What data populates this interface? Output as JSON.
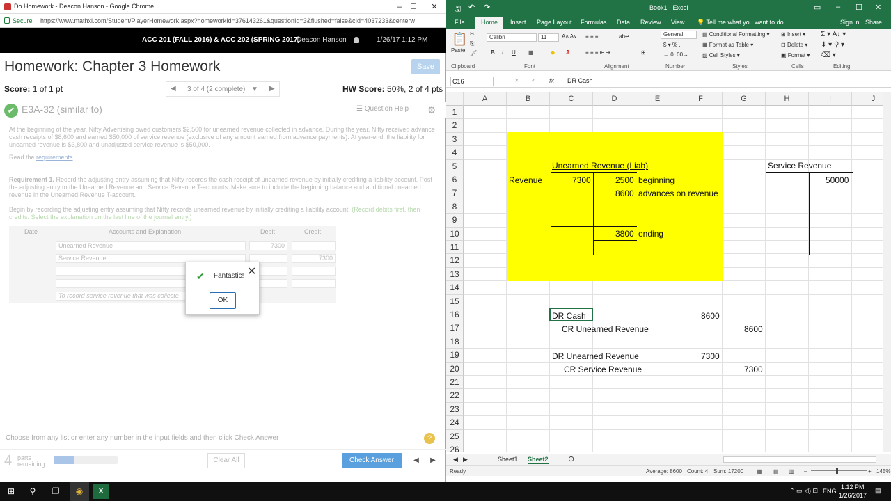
{
  "browser": {
    "window_title": "Do Homework - Deacon Hanson - Google Chrome",
    "secure_label": "Secure",
    "url": "https://www.mathxl.com/Student/PlayerHomework.aspx?homeworkId=376143261&questionId=3&flushed=false&cId=4037233&centerw",
    "minimize": "–",
    "maximize": "☐",
    "close": "✕"
  },
  "header": {
    "course": "ACC 201 (FALL 2016) & ACC 202 (SPRING 2017)",
    "user": "Deacon Hanson",
    "datetime": "1/26/17 1:12 PM"
  },
  "homework": {
    "title": "Homework: Chapter 3 Homework",
    "save_label": "Save",
    "score_label": "Score:",
    "score_value": "1 of 1 pt",
    "pager_text": "3 of 4 (2 complete)",
    "pager_prev": "◀",
    "pager_next": "▶",
    "pager_dropdown": "▼",
    "hw_score_label": "HW Score:",
    "hw_score_value": "50%, 2 of 4 pts",
    "question_id": "E3A-32 (similar to)",
    "check_icon": "✔",
    "help_label": "Question Help",
    "gear_glyph": "⚙",
    "problem_text": "At the beginning of the year, Nifty Advertising owed customers $2,500 for unearned revenue collected in advance. During the year, Nifty received advance cash receipts of $8,600 and earned $50,000 of service revenue (exclusive of any amount earned from advance payments). At year-end, the liability for unearned revenue is $3,800 and unadjusted service revenue is $50,000.",
    "read_prefix": "Read the ",
    "requirements_link": "requirements",
    "read_suffix": ".",
    "req1_bold": "Requirement 1.",
    "req1_text": " Record the adjusting entry assuming that Nifty records the cash receipt of unearned revenue by initially crediting a liability account. Post the adjusting entry to the Unearned Revenue and Service Revenue T-accounts. Make sure to include the beginning balance and additional unearned revenue in the Unearned Revenue T-account.",
    "begin_text": "Begin by recording the adjusting entry assuming that Nifty records unearned revenue by initially crediting a liability account. ",
    "begin_green": "(Record debits first, then credits. Select the explanation on the last line of the journal entry.)",
    "journal": {
      "headers": {
        "date": "Date",
        "accounts": "Accounts and Explanation",
        "debit": "Debit",
        "credit": "Credit"
      },
      "rows": [
        {
          "account": "Unearned Revenue",
          "debit": "7300",
          "credit": ""
        },
        {
          "account": "Service Revenue",
          "debit": "",
          "credit": "7300"
        },
        {
          "account": "",
          "debit": "",
          "credit": ""
        },
        {
          "account": "",
          "debit": "",
          "credit": ""
        }
      ],
      "explanation": "To record service revenue that was collecte"
    },
    "dialog": {
      "message": "Fantastic!",
      "ok": "OK",
      "close": "✕",
      "check": "✔"
    },
    "footer_msg": "Choose from any list or enter any number in the input fields and then click Check Answer",
    "help_q": "?",
    "parts_count": "4",
    "parts_label1": "parts",
    "parts_label2": "remaining",
    "progress": 0.33,
    "clear_all": "Clear All",
    "check_answer": "Check Answer",
    "nav_prev": "◀",
    "nav_next": "▶"
  },
  "excel": {
    "title": "Book1 - Excel",
    "tabs": [
      "File",
      "Home",
      "Insert",
      "Page Layout",
      "Formulas",
      "Data",
      "Review",
      "View"
    ],
    "tell_me": "Tell me what you want to do...",
    "sign_in": "Sign in",
    "share": "Share",
    "ribbon": {
      "paste": "Paste",
      "font_name": "Calibri",
      "font_size": "11",
      "number_format": "General",
      "conditional": "Conditional Formatting",
      "format_table": "Format as Table",
      "cell_styles": "Cell Styles",
      "insert": "Insert",
      "delete": "Delete",
      "format": "Format",
      "groups": [
        "Clipboard",
        "Font",
        "Alignment",
        "Number",
        "Styles",
        "Cells",
        "Editing"
      ]
    },
    "name_box": "C16",
    "formula": "DR Cash",
    "fx": "fx",
    "columns": [
      "A",
      "B",
      "C",
      "D",
      "E",
      "F",
      "G",
      "H",
      "I",
      "J"
    ],
    "rows": [
      "1",
      "2",
      "3",
      "4",
      "5",
      "6",
      "7",
      "8",
      "9",
      "10",
      "11",
      "12",
      "13",
      "14",
      "15",
      "16",
      "17",
      "18",
      "19",
      "20",
      "21",
      "22",
      "23",
      "24",
      "25",
      "26"
    ],
    "cells": {
      "unearned_title": "Unearned Revenue (Liab)",
      "service_title": "Service Revenue",
      "revenue_label": "Revenue",
      "d_7300": "7300",
      "e_2500": "2500",
      "beginning": "beginning",
      "e_8600": "8600",
      "advances": "advances on revenue",
      "e_3800": "3800",
      "ending": "ending",
      "sr_50000": "50000",
      "dr_cash": "DR Cash",
      "dr_cash_amt": "8600",
      "cr_unearned": "CR Unearned Revenue",
      "cr_unearned_amt": "8600",
      "dr_unearned": "DR Unearned Revenue",
      "dr_unearned_amt": "7300",
      "cr_service": "CR Service Revenue",
      "cr_service_amt": "7300"
    },
    "sheets": [
      "Sheet1",
      "Sheet2"
    ],
    "add_sheet": "⊕",
    "status": {
      "ready": "Ready",
      "average": "Average: 8600",
      "count": "Count: 4",
      "sum": "Sum: 17200",
      "zoom": "145%"
    }
  },
  "taskbar": {
    "time": "1:12 PM",
    "date": "1/26/2017",
    "lang": "ENG",
    "start_icon": "⊞",
    "search_icon": "⚲",
    "taskview_icon": "❐",
    "chrome_icon": "◉",
    "excel_icon": "X",
    "tray_icons": "⌃ ▭ ◁) ⊡",
    "notify_icon": "▤"
  },
  "colors": {
    "excel_green": "#217346",
    "cell_yellow": "#ffff00",
    "check_green": "#6cbb6a",
    "button_blue": "#5ba0de"
  }
}
